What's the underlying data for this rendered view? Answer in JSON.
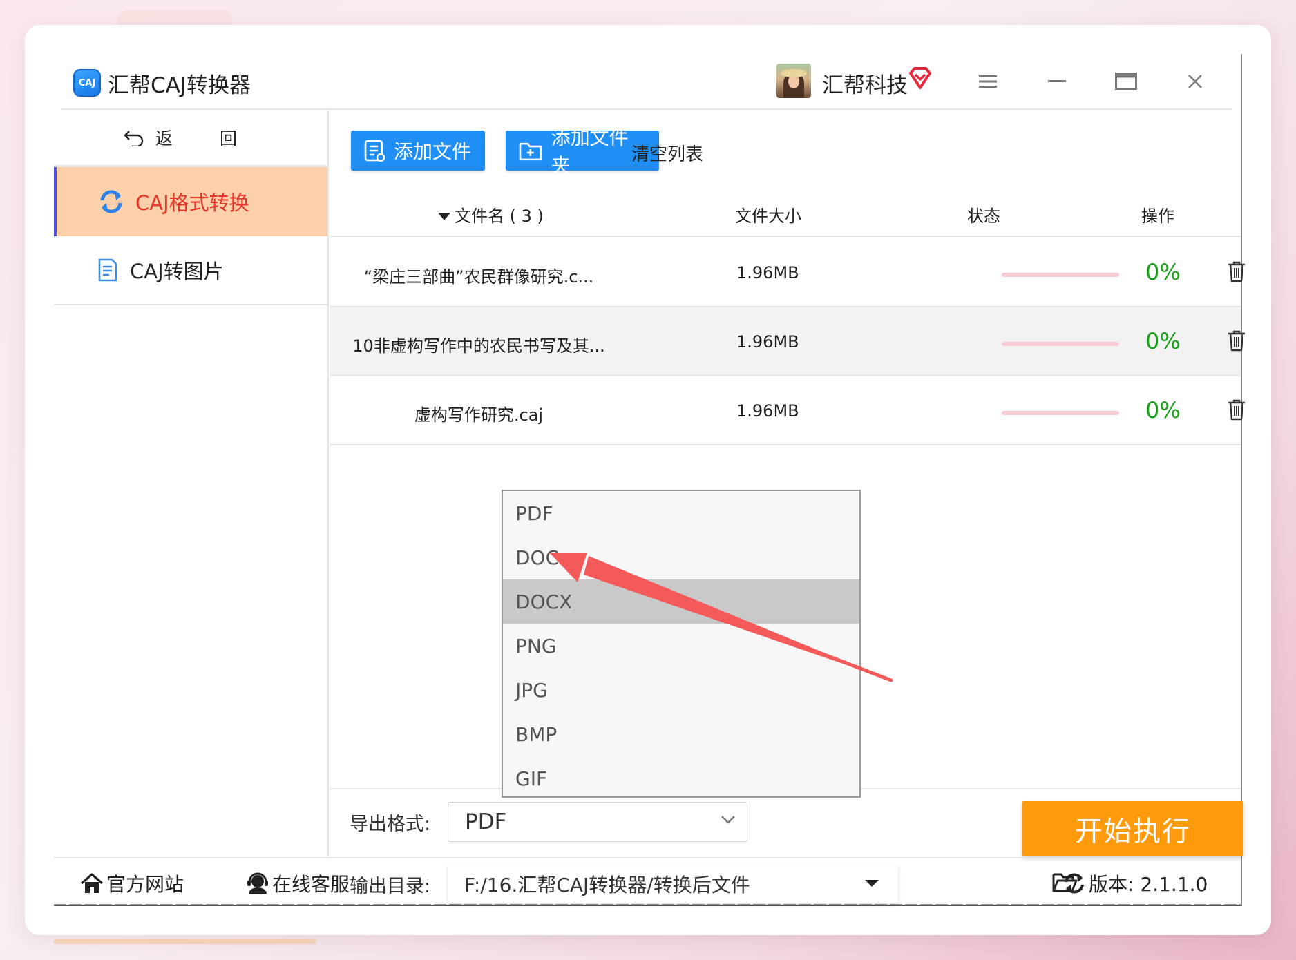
{
  "app": {
    "title": "汇帮CAJ转换器",
    "logo_text": "CAJ",
    "company": "汇帮科技"
  },
  "sidebar": {
    "back_label": "返 回",
    "items": [
      {
        "label": "CAJ格式转换",
        "icon": "refresh-icon",
        "active": true
      },
      {
        "label": "CAJ转图片",
        "icon": "document-icon",
        "active": false
      }
    ]
  },
  "toolbar": {
    "add_file": "添加文件",
    "add_folder": "添加文件夹",
    "clear_list": "清空列表"
  },
  "table": {
    "headers": {
      "name": "文件名 ( 3 )",
      "size": "文件大小",
      "status": "状态",
      "action": "操作"
    },
    "rows": [
      {
        "name": "“梁庄三部曲”农民群像研究.c...",
        "size": "1.96MB",
        "progress": "0%"
      },
      {
        "name": "10非虚构写作中的农民书写及其...",
        "size": "1.96MB",
        "progress": "0%"
      },
      {
        "name": "虚构写作研究.caj",
        "size": "1.96MB",
        "progress": "0%"
      }
    ]
  },
  "export": {
    "format_label": "导出格式:",
    "format_value": "PDF",
    "options": [
      "PDF",
      "DOC",
      "DOCX",
      "PNG",
      "JPG",
      "BMP",
      "GIF"
    ],
    "highlighted_option": "DOCX",
    "output_label": "输出目录:",
    "output_path": "F:/16.汇帮CAJ转换器/转换后文件",
    "start_button": "开始执行"
  },
  "footer": {
    "website": "官方网站",
    "support": "在线客服",
    "version": "版本: 2.1.1.0"
  },
  "colors": {
    "accent_blue": "#1f8ff5",
    "start_orange": "#ff9a0d",
    "active_nav_bg": "#fcd0aa",
    "active_nav_text": "#e5362a",
    "progress_green": "#1aa31a",
    "annotation_arrow": "#f45a5a"
  }
}
